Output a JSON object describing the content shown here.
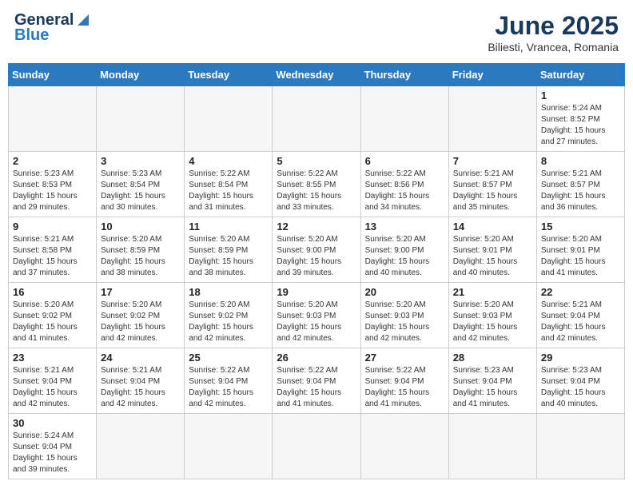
{
  "header": {
    "logo_general": "General",
    "logo_blue": "Blue",
    "month_title": "June 2025",
    "location": "Biliesti, Vrancea, Romania"
  },
  "weekdays": [
    "Sunday",
    "Monday",
    "Tuesday",
    "Wednesday",
    "Thursday",
    "Friday",
    "Saturday"
  ],
  "days": [
    {
      "num": "",
      "info": ""
    },
    {
      "num": "",
      "info": ""
    },
    {
      "num": "",
      "info": ""
    },
    {
      "num": "",
      "info": ""
    },
    {
      "num": "",
      "info": ""
    },
    {
      "num": "",
      "info": ""
    },
    {
      "num": "1",
      "sunrise": "Sunrise: 5:24 AM",
      "sunset": "Sunset: 8:52 PM",
      "daylight": "Daylight: 15 hours and 27 minutes."
    },
    {
      "num": "2",
      "sunrise": "Sunrise: 5:23 AM",
      "sunset": "Sunset: 8:53 PM",
      "daylight": "Daylight: 15 hours and 29 minutes."
    },
    {
      "num": "3",
      "sunrise": "Sunrise: 5:23 AM",
      "sunset": "Sunset: 8:54 PM",
      "daylight": "Daylight: 15 hours and 30 minutes."
    },
    {
      "num": "4",
      "sunrise": "Sunrise: 5:22 AM",
      "sunset": "Sunset: 8:54 PM",
      "daylight": "Daylight: 15 hours and 31 minutes."
    },
    {
      "num": "5",
      "sunrise": "Sunrise: 5:22 AM",
      "sunset": "Sunset: 8:55 PM",
      "daylight": "Daylight: 15 hours and 33 minutes."
    },
    {
      "num": "6",
      "sunrise": "Sunrise: 5:22 AM",
      "sunset": "Sunset: 8:56 PM",
      "daylight": "Daylight: 15 hours and 34 minutes."
    },
    {
      "num": "7",
      "sunrise": "Sunrise: 5:21 AM",
      "sunset": "Sunset: 8:57 PM",
      "daylight": "Daylight: 15 hours and 35 minutes."
    },
    {
      "num": "8",
      "sunrise": "Sunrise: 5:21 AM",
      "sunset": "Sunset: 8:57 PM",
      "daylight": "Daylight: 15 hours and 36 minutes."
    },
    {
      "num": "9",
      "sunrise": "Sunrise: 5:21 AM",
      "sunset": "Sunset: 8:58 PM",
      "daylight": "Daylight: 15 hours and 37 minutes."
    },
    {
      "num": "10",
      "sunrise": "Sunrise: 5:20 AM",
      "sunset": "Sunset: 8:59 PM",
      "daylight": "Daylight: 15 hours and 38 minutes."
    },
    {
      "num": "11",
      "sunrise": "Sunrise: 5:20 AM",
      "sunset": "Sunset: 8:59 PM",
      "daylight": "Daylight: 15 hours and 38 minutes."
    },
    {
      "num": "12",
      "sunrise": "Sunrise: 5:20 AM",
      "sunset": "Sunset: 9:00 PM",
      "daylight": "Daylight: 15 hours and 39 minutes."
    },
    {
      "num": "13",
      "sunrise": "Sunrise: 5:20 AM",
      "sunset": "Sunset: 9:00 PM",
      "daylight": "Daylight: 15 hours and 40 minutes."
    },
    {
      "num": "14",
      "sunrise": "Sunrise: 5:20 AM",
      "sunset": "Sunset: 9:01 PM",
      "daylight": "Daylight: 15 hours and 40 minutes."
    },
    {
      "num": "15",
      "sunrise": "Sunrise: 5:20 AM",
      "sunset": "Sunset: 9:01 PM",
      "daylight": "Daylight: 15 hours and 41 minutes."
    },
    {
      "num": "16",
      "sunrise": "Sunrise: 5:20 AM",
      "sunset": "Sunset: 9:02 PM",
      "daylight": "Daylight: 15 hours and 41 minutes."
    },
    {
      "num": "17",
      "sunrise": "Sunrise: 5:20 AM",
      "sunset": "Sunset: 9:02 PM",
      "daylight": "Daylight: 15 hours and 42 minutes."
    },
    {
      "num": "18",
      "sunrise": "Sunrise: 5:20 AM",
      "sunset": "Sunset: 9:02 PM",
      "daylight": "Daylight: 15 hours and 42 minutes."
    },
    {
      "num": "19",
      "sunrise": "Sunrise: 5:20 AM",
      "sunset": "Sunset: 9:03 PM",
      "daylight": "Daylight: 15 hours and 42 minutes."
    },
    {
      "num": "20",
      "sunrise": "Sunrise: 5:20 AM",
      "sunset": "Sunset: 9:03 PM",
      "daylight": "Daylight: 15 hours and 42 minutes."
    },
    {
      "num": "21",
      "sunrise": "Sunrise: 5:20 AM",
      "sunset": "Sunset: 9:03 PM",
      "daylight": "Daylight: 15 hours and 42 minutes."
    },
    {
      "num": "22",
      "sunrise": "Sunrise: 5:21 AM",
      "sunset": "Sunset: 9:04 PM",
      "daylight": "Daylight: 15 hours and 42 minutes."
    },
    {
      "num": "23",
      "sunrise": "Sunrise: 5:21 AM",
      "sunset": "Sunset: 9:04 PM",
      "daylight": "Daylight: 15 hours and 42 minutes."
    },
    {
      "num": "24",
      "sunrise": "Sunrise: 5:21 AM",
      "sunset": "Sunset: 9:04 PM",
      "daylight": "Daylight: 15 hours and 42 minutes."
    },
    {
      "num": "25",
      "sunrise": "Sunrise: 5:22 AM",
      "sunset": "Sunset: 9:04 PM",
      "daylight": "Daylight: 15 hours and 42 minutes."
    },
    {
      "num": "26",
      "sunrise": "Sunrise: 5:22 AM",
      "sunset": "Sunset: 9:04 PM",
      "daylight": "Daylight: 15 hours and 41 minutes."
    },
    {
      "num": "27",
      "sunrise": "Sunrise: 5:22 AM",
      "sunset": "Sunset: 9:04 PM",
      "daylight": "Daylight: 15 hours and 41 minutes."
    },
    {
      "num": "28",
      "sunrise": "Sunrise: 5:23 AM",
      "sunset": "Sunset: 9:04 PM",
      "daylight": "Daylight: 15 hours and 41 minutes."
    },
    {
      "num": "29",
      "sunrise": "Sunrise: 5:23 AM",
      "sunset": "Sunset: 9:04 PM",
      "daylight": "Daylight: 15 hours and 40 minutes."
    },
    {
      "num": "30",
      "sunrise": "Sunrise: 5:24 AM",
      "sunset": "Sunset: 9:04 PM",
      "daylight": "Daylight: 15 hours and 39 minutes."
    },
    {
      "num": "",
      "info": ""
    },
    {
      "num": "",
      "info": ""
    },
    {
      "num": "",
      "info": ""
    },
    {
      "num": "",
      "info": ""
    },
    {
      "num": "",
      "info": ""
    }
  ]
}
